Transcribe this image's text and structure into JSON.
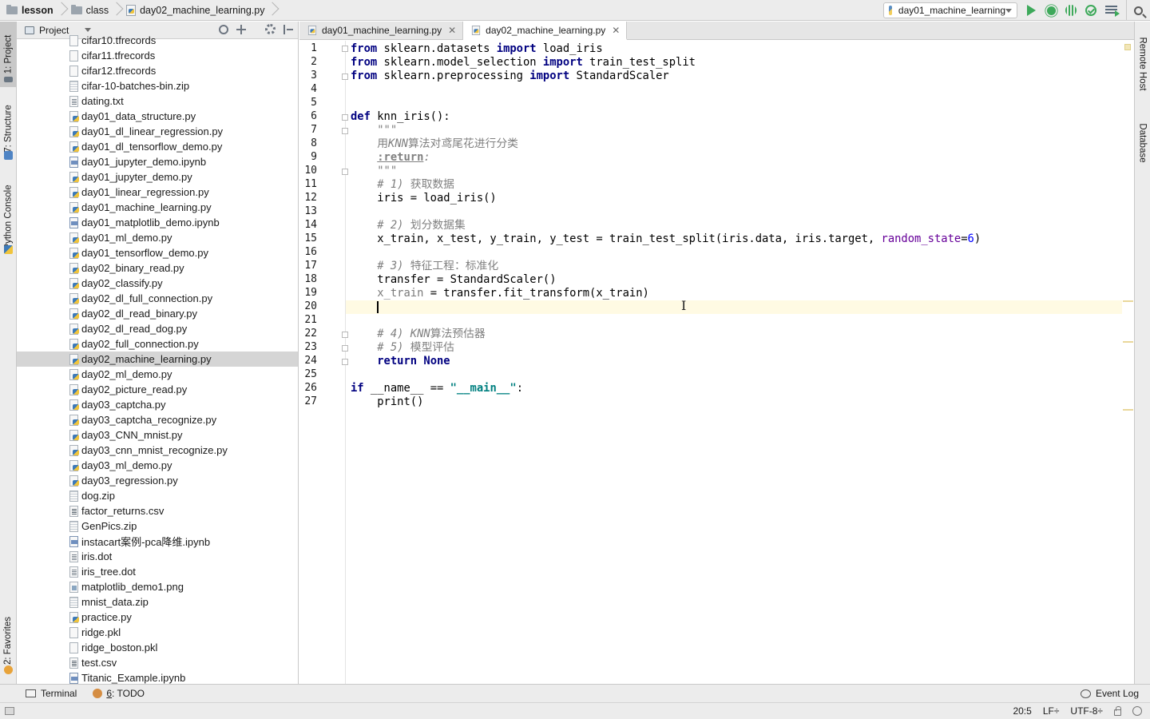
{
  "breadcrumb": {
    "items": [
      "lesson",
      "class",
      "day02_machine_learning.py"
    ]
  },
  "toolbar": {
    "run_config": "day01_machine_learning"
  },
  "left_strip": {
    "project": "1: Project",
    "structure": "7: Structure",
    "python_console": "Python Console",
    "favorites": "2: Favorites"
  },
  "right_strip": {
    "remote_host": "Remote Host",
    "database": "Database"
  },
  "project_panel": {
    "title": "Project",
    "files": [
      {
        "name": "cifar10.tfrecords",
        "type": "blank"
      },
      {
        "name": "cifar11.tfrecords",
        "type": "blank"
      },
      {
        "name": "cifar12.tfrecords",
        "type": "blank"
      },
      {
        "name": "cifar-10-batches-bin.zip",
        "type": "zip"
      },
      {
        "name": "dating.txt",
        "type": "txt"
      },
      {
        "name": "day01_data_structure.py",
        "type": "py"
      },
      {
        "name": "day01_dl_linear_regression.py",
        "type": "py"
      },
      {
        "name": "day01_dl_tensorflow_demo.py",
        "type": "py"
      },
      {
        "name": "day01_jupyter_demo.ipynb",
        "type": "nb"
      },
      {
        "name": "day01_jupyter_demo.py",
        "type": "py"
      },
      {
        "name": "day01_linear_regression.py",
        "type": "py"
      },
      {
        "name": "day01_machine_learning.py",
        "type": "py"
      },
      {
        "name": "day01_matplotlib_demo.ipynb",
        "type": "nb"
      },
      {
        "name": "day01_ml_demo.py",
        "type": "py"
      },
      {
        "name": "day01_tensorflow_demo.py",
        "type": "py"
      },
      {
        "name": "day02_binary_read.py",
        "type": "py"
      },
      {
        "name": "day02_classify.py",
        "type": "py"
      },
      {
        "name": "day02_dl_full_connection.py",
        "type": "py"
      },
      {
        "name": "day02_dl_read_binary.py",
        "type": "py"
      },
      {
        "name": "day02_dl_read_dog.py",
        "type": "py"
      },
      {
        "name": "day02_full_connection.py",
        "type": "py"
      },
      {
        "name": "day02_machine_learning.py",
        "type": "py",
        "selected": true
      },
      {
        "name": "day02_ml_demo.py",
        "type": "py"
      },
      {
        "name": "day02_picture_read.py",
        "type": "py"
      },
      {
        "name": "day03_captcha.py",
        "type": "py"
      },
      {
        "name": "day03_captcha_recognize.py",
        "type": "py"
      },
      {
        "name": "day03_CNN_mnist.py",
        "type": "py"
      },
      {
        "name": "day03_cnn_mnist_recognize.py",
        "type": "py"
      },
      {
        "name": "day03_ml_demo.py",
        "type": "py"
      },
      {
        "name": "day03_regression.py",
        "type": "py"
      },
      {
        "name": "dog.zip",
        "type": "zip"
      },
      {
        "name": "factor_returns.csv",
        "type": "csv"
      },
      {
        "name": "GenPics.zip",
        "type": "zip"
      },
      {
        "name": "instacart案例-pca降维.ipynb",
        "type": "nb"
      },
      {
        "name": "iris.dot",
        "type": "txt"
      },
      {
        "name": "iris_tree.dot",
        "type": "txt"
      },
      {
        "name": "matplotlib_demo1.png",
        "type": "img"
      },
      {
        "name": "mnist_data.zip",
        "type": "zip"
      },
      {
        "name": "practice.py",
        "type": "py"
      },
      {
        "name": "ridge.pkl",
        "type": "blank"
      },
      {
        "name": "ridge_boston.pkl",
        "type": "blank"
      },
      {
        "name": "test.csv",
        "type": "csv"
      },
      {
        "name": "Titanic_Example.ipynb",
        "type": "nb"
      }
    ]
  },
  "tabs": [
    {
      "label": "day01_machine_learning.py",
      "active": false
    },
    {
      "label": "day02_machine_learning.py",
      "active": true
    }
  ],
  "editor": {
    "line_numbers": [
      "1",
      "2",
      "3",
      "4",
      "5",
      "6",
      "7",
      "8",
      "9",
      "10",
      "11",
      "12",
      "13",
      "14",
      "15",
      "16",
      "17",
      "18",
      "19",
      "20",
      "21",
      "22",
      "23",
      "24",
      "25",
      "26",
      "27"
    ],
    "code": {
      "l1": {
        "a": "from",
        "b": " sklearn.datasets ",
        "c": "import",
        "d": " load_iris"
      },
      "l2": {
        "a": "from",
        "b": " sklearn.model_selection ",
        "c": "import",
        "d": " train_test_split"
      },
      "l3": {
        "a": "from",
        "b": " sklearn.preprocessing ",
        "c": "import",
        "d": " StandardScaler"
      },
      "l6": {
        "a": "def",
        "b": " knn_iris():"
      },
      "l7": "    \"\"\"",
      "l8": {
        "indent": "    ",
        "a": "用",
        "b": "KNN",
        "c": "算法对鸢尾花进行分类"
      },
      "l9": {
        "indent": "    ",
        "a": ":return",
        "b": ":"
      },
      "l10": "    \"\"\"",
      "l11": {
        "indent": "    ",
        "a": "# 1)",
        "b": " 获取数据"
      },
      "l12": "    iris = load_iris()",
      "l14": {
        "indent": "    ",
        "a": "# 2)",
        "b": " 划分数据集"
      },
      "l15": {
        "a": "    x_train, x_test, y_train, y_test = train_test_split(iris.data, iris.target, ",
        "b": "random_state",
        "c": "=",
        "d": "6",
        "e": ")"
      },
      "l17": {
        "indent": "    ",
        "a": "# 3)",
        "b": " 特征工程：标准化"
      },
      "l18": "    transfer = StandardScaler()",
      "l19": {
        "indent": "    ",
        "a": "x_train",
        "b": " = transfer.fit_transform(x_train)"
      },
      "l22": {
        "indent": "    ",
        "a": "# 4)",
        "b": " KNN",
        "c": "算法预估器"
      },
      "l23": {
        "indent": "    ",
        "a": "# 5)",
        "b": " 模型评估"
      },
      "l24": {
        "indent": "    ",
        "a": "return",
        "b": " None"
      },
      "l26": {
        "a": "if",
        "b": " __name__ == ",
        "c": "\"__main__\"",
        "d": ":"
      },
      "l27": "    print()"
    }
  },
  "bottom_bar": {
    "terminal": "Terminal",
    "todo_num": "6",
    "todo_label": ": TODO",
    "event_log": "Event Log"
  },
  "status_bar": {
    "position": "20:5",
    "line_sep": "LF÷",
    "encoding": "UTF-8÷"
  }
}
